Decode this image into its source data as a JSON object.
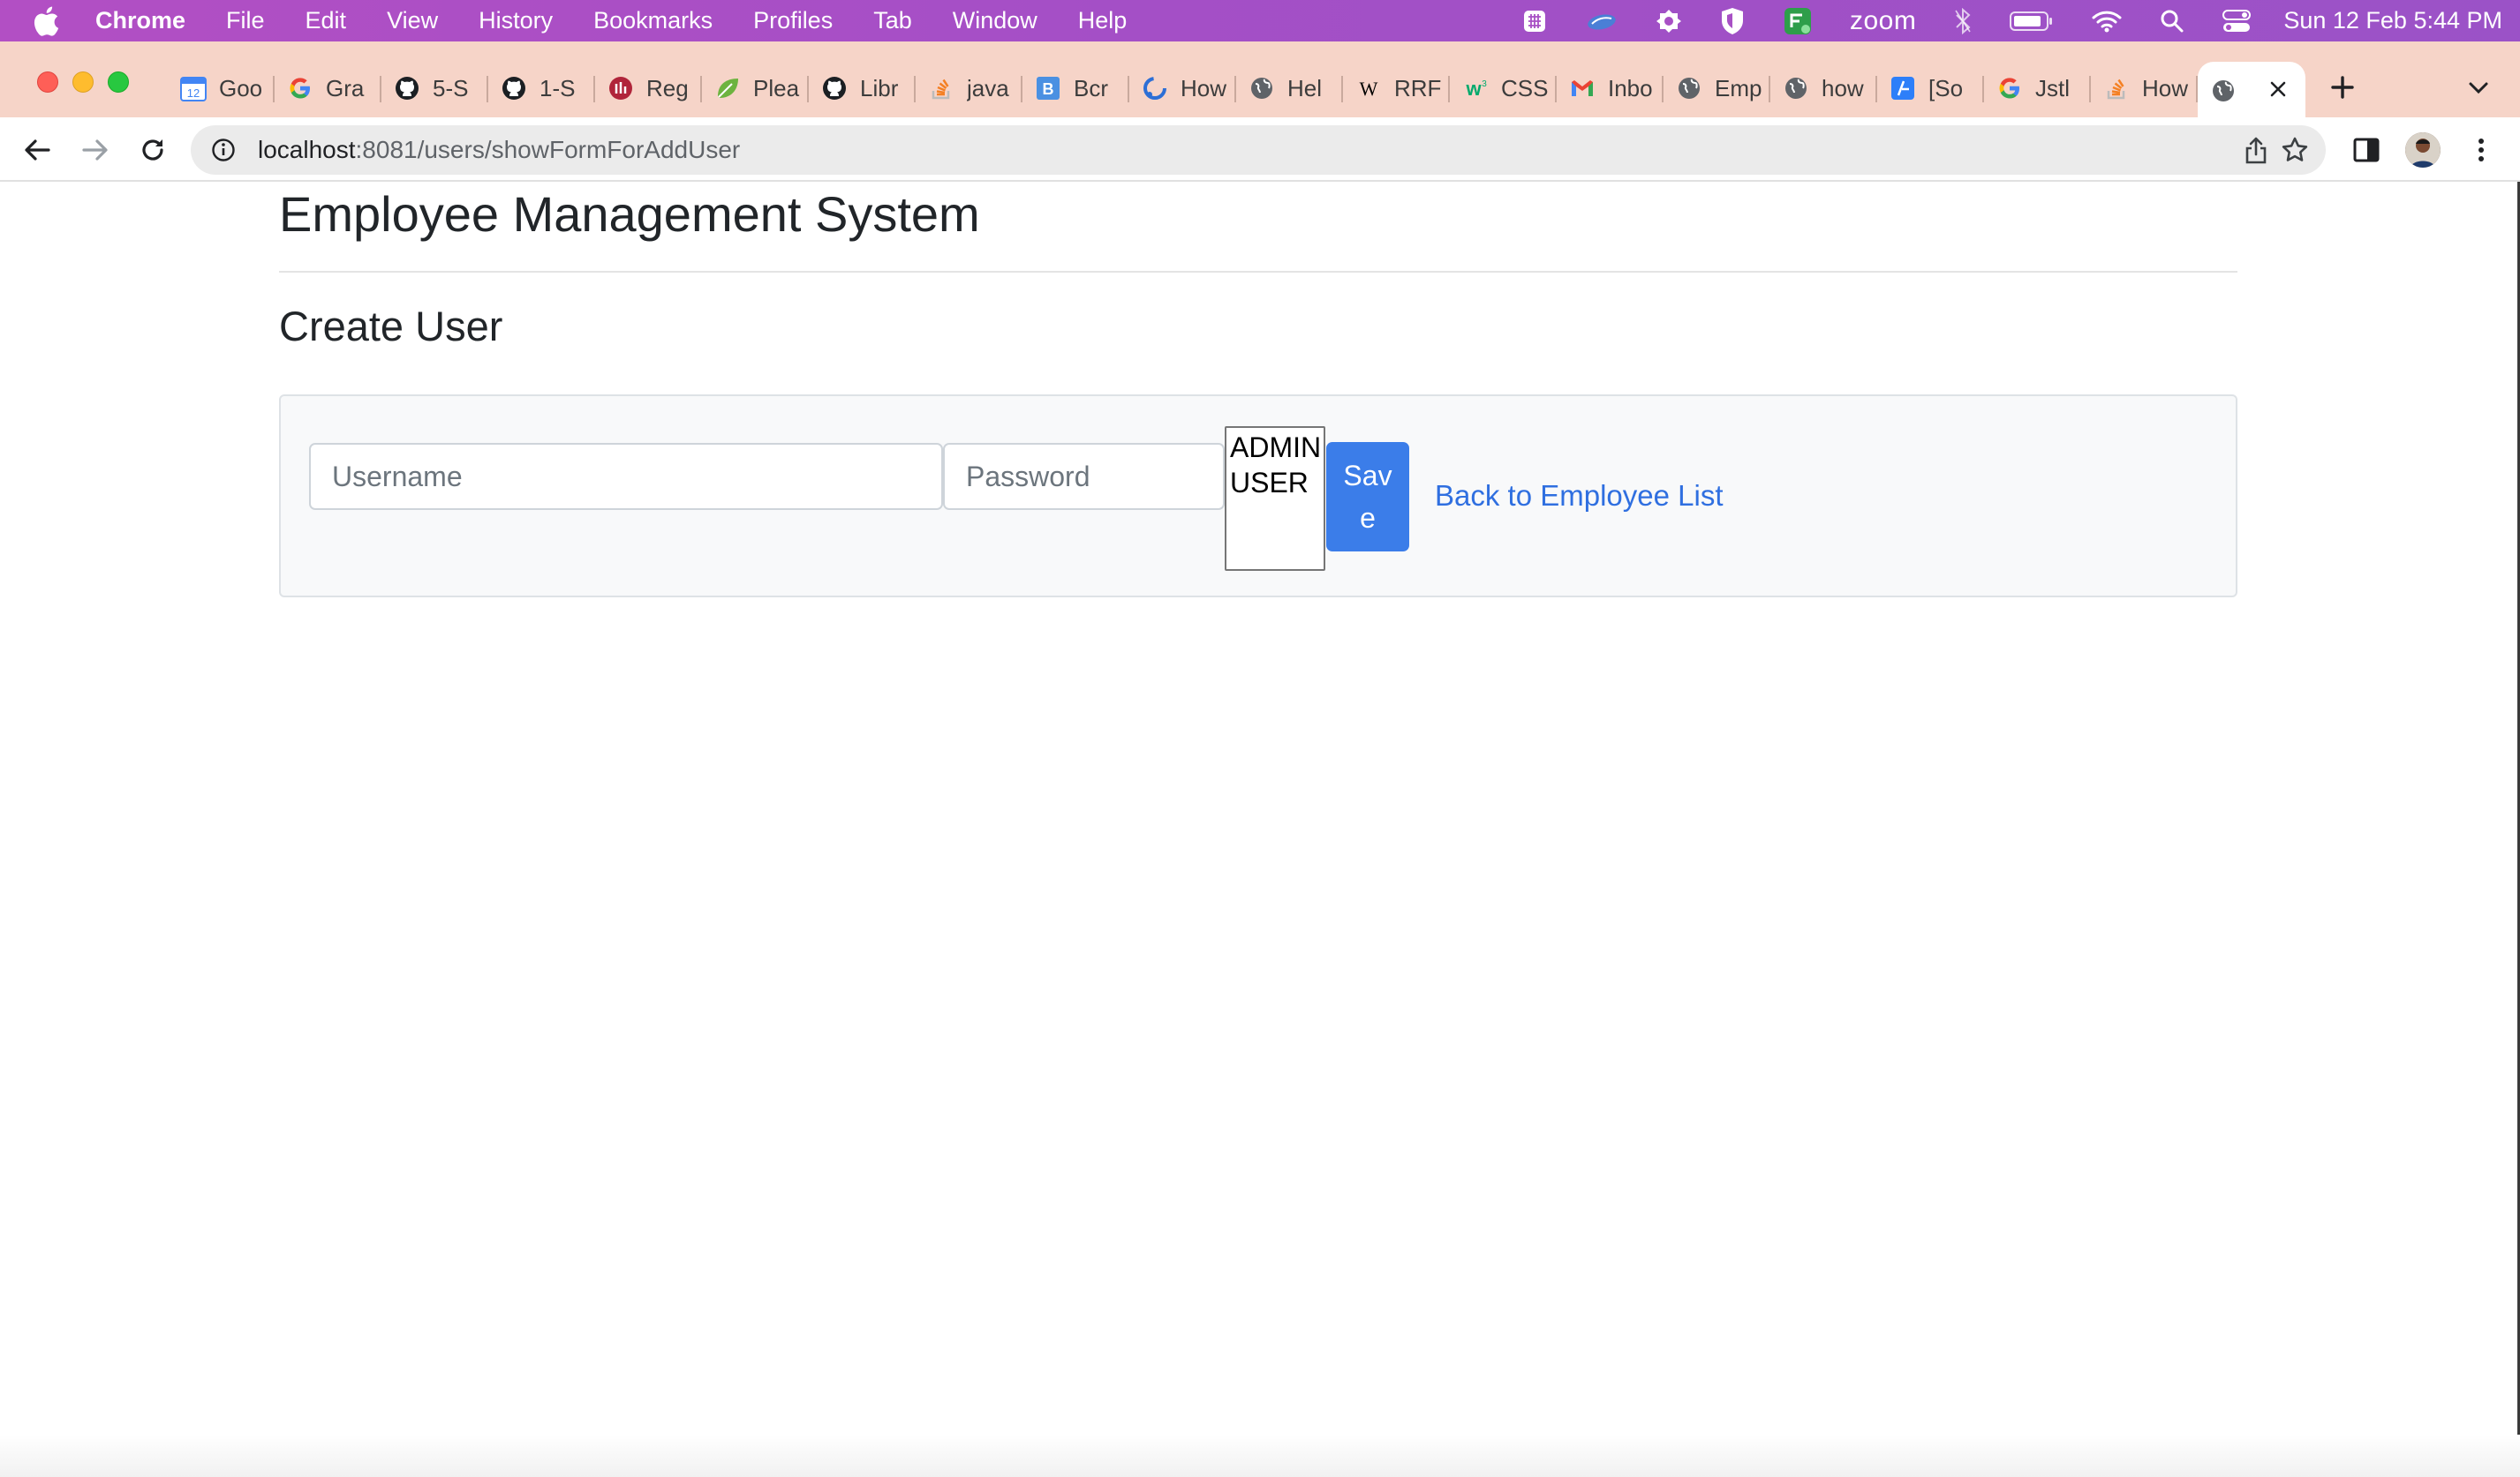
{
  "menubar": {
    "app_name": "Chrome",
    "menus": [
      "File",
      "Edit",
      "View",
      "History",
      "Bookmarks",
      "Profiles",
      "Tab",
      "Window",
      "Help"
    ],
    "status_zoom": "zoom",
    "clock": "Sun 12 Feb  5:44 PM"
  },
  "tabs": [
    {
      "title": "Goo",
      "icon": "calendar-icon"
    },
    {
      "title": "Gra",
      "icon": "google-icon"
    },
    {
      "title": "5-S",
      "icon": "github-icon"
    },
    {
      "title": "1-S",
      "icon": "github-icon"
    },
    {
      "title": "Reg",
      "icon": "site-icon"
    },
    {
      "title": "Plea",
      "icon": "leaf-icon"
    },
    {
      "title": "Libr",
      "icon": "github-icon"
    },
    {
      "title": "java",
      "icon": "stackoverflow-icon"
    },
    {
      "title": "Bcr",
      "icon": "b-icon"
    },
    {
      "title": "How",
      "icon": "site-icon"
    },
    {
      "title": "Hel",
      "icon": "globe-icon"
    },
    {
      "title": "RRF",
      "icon": "wikipedia-icon"
    },
    {
      "title": "CSS",
      "icon": "w3schools-icon"
    },
    {
      "title": "Inbo",
      "icon": "gmail-icon"
    },
    {
      "title": "Emp",
      "icon": "globe-icon"
    },
    {
      "title": "how",
      "icon": "globe-icon"
    },
    {
      "title": "[So",
      "icon": "site-icon"
    },
    {
      "title": "Jstl",
      "icon": "google-icon"
    },
    {
      "title": "How",
      "icon": "stackoverflow-icon"
    }
  ],
  "active_tab": {
    "icon": "globe-icon"
  },
  "address_bar": {
    "host": "localhost",
    "path": ":8081/users/showFormForAddUser"
  },
  "page": {
    "title": "Employee Management System",
    "section_title": "Create User",
    "form": {
      "username_placeholder": "Username",
      "password_placeholder": "Password",
      "role_options": [
        "ADMIN",
        "USER"
      ],
      "save_label": "Save",
      "back_link": "Back to Employee List"
    }
  },
  "colors": {
    "accent": "#3b7de9",
    "link": "#2f6fe0",
    "menubar": "#a850c5",
    "tabstrip": "#f6d4c8"
  }
}
